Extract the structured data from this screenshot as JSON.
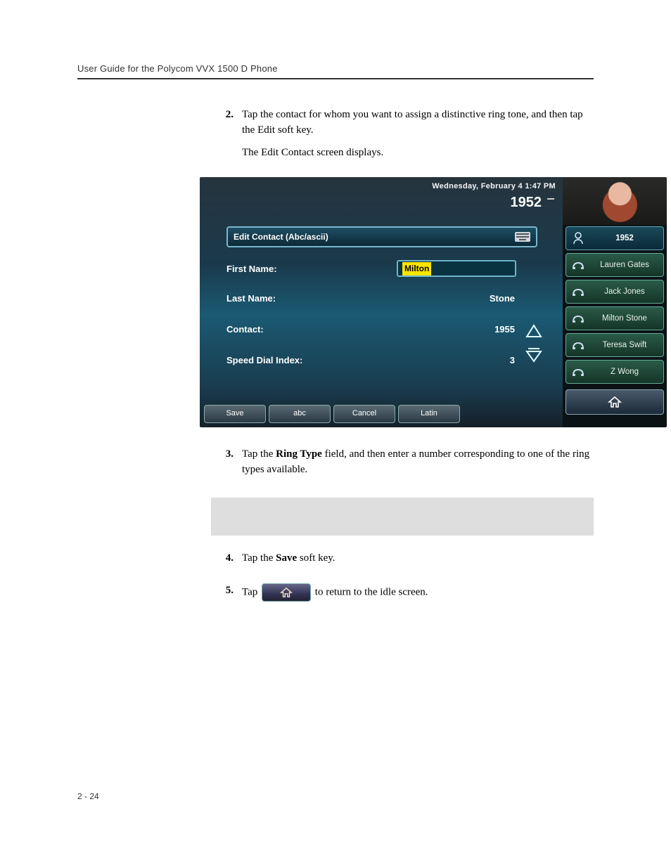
{
  "header": {
    "title": "User Guide for the Polycom VVX 1500 D Phone"
  },
  "steps": {
    "s2": {
      "num": "2.",
      "p1": "Tap the contact for whom you want to assign a distinctive ring tone, and then tap the Edit soft key.",
      "p2": "The Edit Contact screen displays."
    },
    "s3": {
      "num": "3.",
      "prefix": "Tap the ",
      "bold": "Ring Type",
      "suffix": " field, and then enter a number corresponding to one of the ring types available."
    },
    "s4": {
      "num": "4.",
      "prefix": "Tap the ",
      "bold": "Save",
      "suffix": " soft key."
    },
    "s5": {
      "num": "5.",
      "prefix": "Tap ",
      "suffix": " to return to the idle screen."
    }
  },
  "screenshot": {
    "status_date": "Wednesday, February 4  1:47 PM",
    "extension": "1952",
    "title": "Edit Contact (Abc/ascii)",
    "fields": {
      "first_name": {
        "label": "First Name:",
        "value": "Milton"
      },
      "last_name": {
        "label": "Last Name:",
        "value": "Stone"
      },
      "contact": {
        "label": "Contact:",
        "value": "1955"
      },
      "speed_dial": {
        "label": "Speed Dial Index:",
        "value": "3"
      }
    },
    "softkeys": [
      "Save",
      "abc",
      "Cancel",
      "Latin"
    ],
    "right_list": [
      "1952",
      "Lauren Gates",
      "Jack Jones",
      "Milton Stone",
      "Teresa Swift",
      "Z Wong"
    ]
  },
  "page_num": "2 - 24"
}
